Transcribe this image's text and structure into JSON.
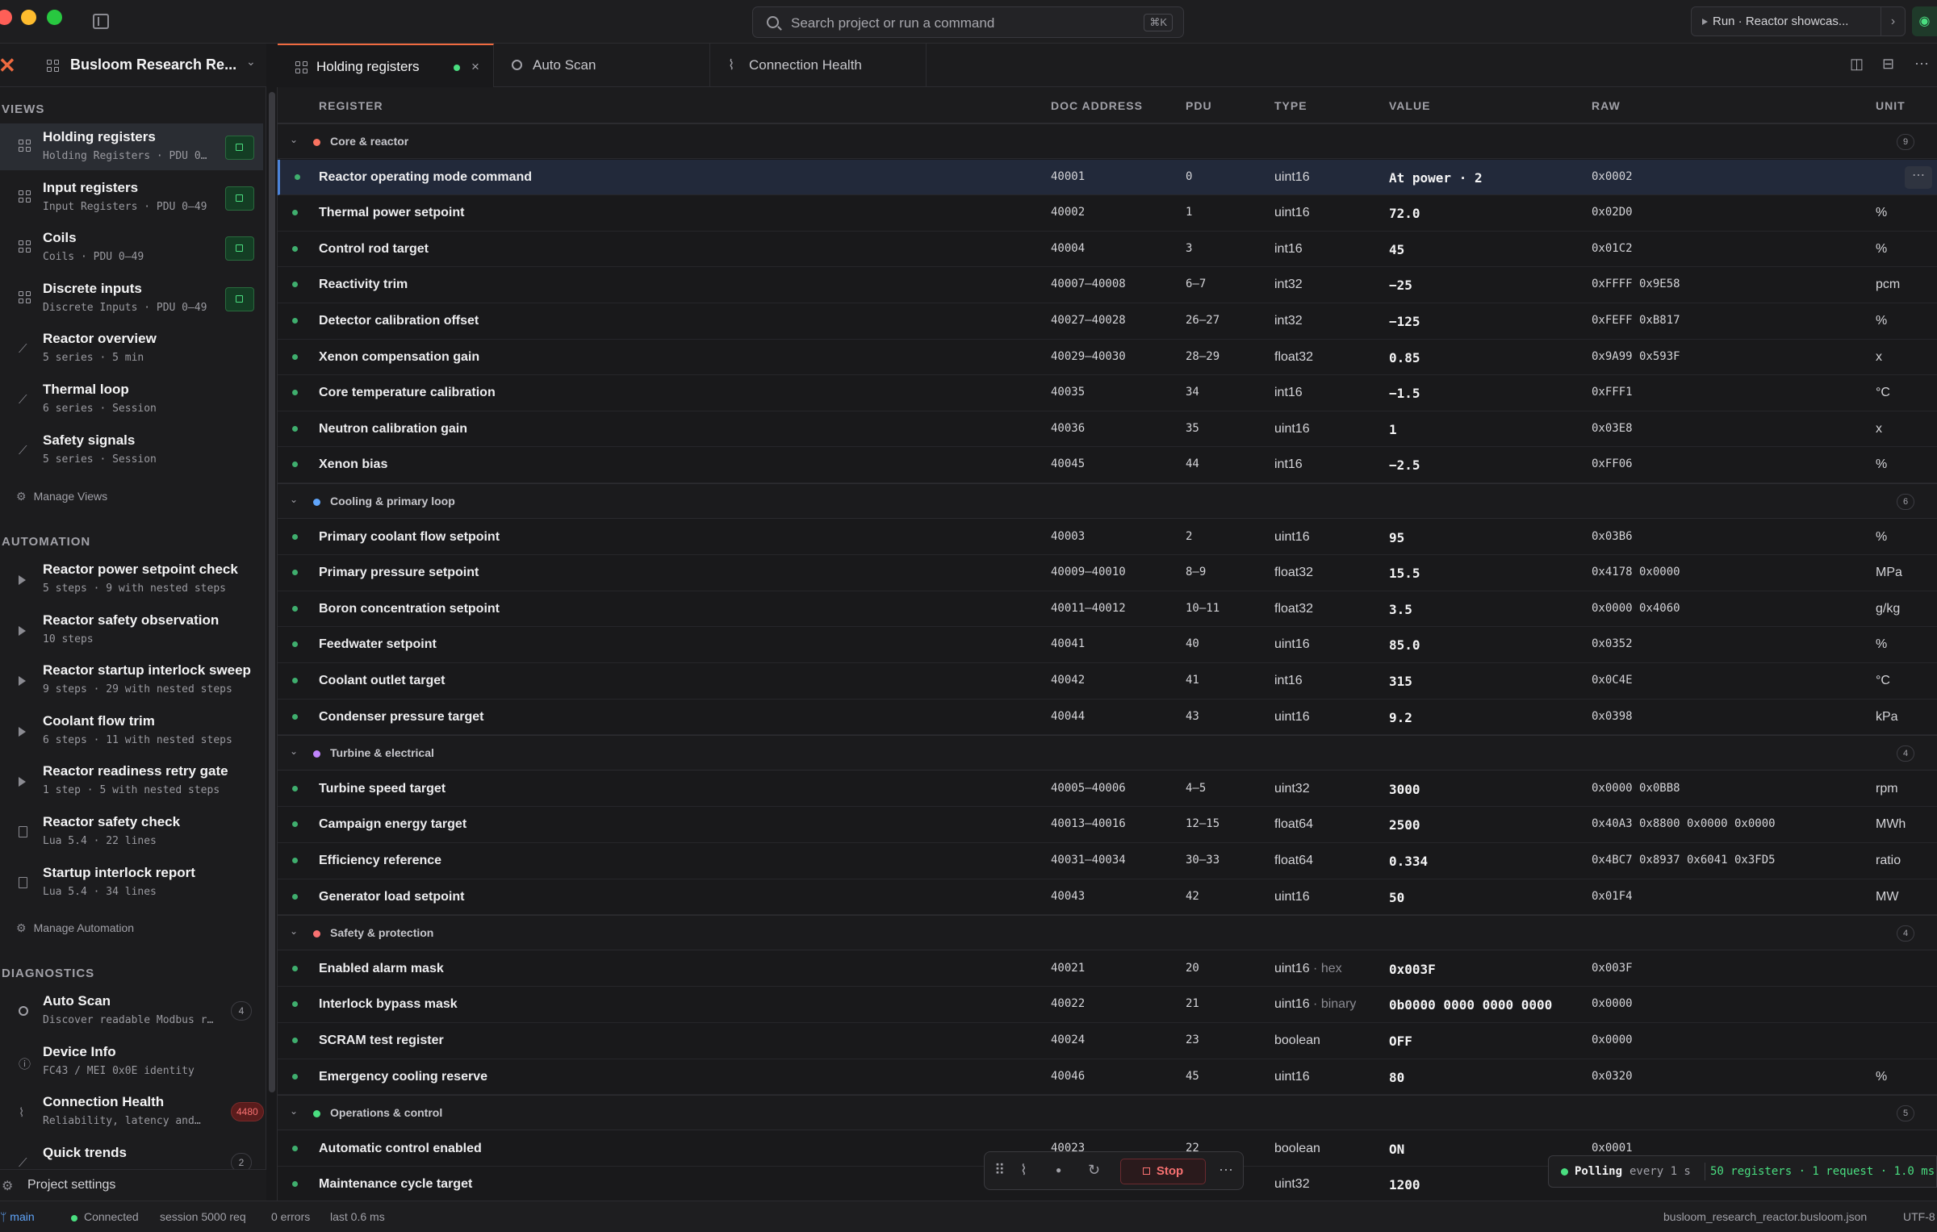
{
  "topbar": {
    "search_placeholder": "Search project or run a command",
    "search_shortcut": "⌘K",
    "run_label": "Run · Reactor showcas..."
  },
  "project": {
    "name": "Busloom Research Re..."
  },
  "tabs": [
    {
      "label": "Holding registers",
      "icon": "grid-icon",
      "dirty": true
    },
    {
      "label": "Auto Scan",
      "icon": "search-icon"
    },
    {
      "label": "Connection Health",
      "icon": "pulse-icon"
    }
  ],
  "sidebar": {
    "views_title": "VIEWS",
    "views": [
      {
        "title": "Holding registers",
        "sub": "Holding Registers · PDU 0…",
        "icon": "grid-icon",
        "live": true
      },
      {
        "title": "Input registers",
        "sub": "Input Registers · PDU 0–49",
        "icon": "grid-icon",
        "live": true
      },
      {
        "title": "Coils",
        "sub": "Coils · PDU 0–49",
        "icon": "grid-icon",
        "live": true
      },
      {
        "title": "Discrete inputs",
        "sub": "Discrete Inputs · PDU 0–49",
        "icon": "grid-icon",
        "live": true
      },
      {
        "title": "Reactor overview",
        "sub": "5 series · 5 min",
        "icon": "chart-icon"
      },
      {
        "title": "Thermal loop",
        "sub": "6 series · Session",
        "icon": "chart-icon"
      },
      {
        "title": "Safety signals",
        "sub": "5 series · Session",
        "icon": "chart-icon"
      }
    ],
    "manage_views": "Manage Views",
    "automation_title": "AUTOMATION",
    "automation": [
      {
        "title": "Reactor power setpoint check",
        "sub": "5 steps · 9 with nested steps",
        "icon": "play-icon"
      },
      {
        "title": "Reactor safety observation",
        "sub": "10 steps",
        "icon": "play-icon"
      },
      {
        "title": "Reactor startup interlock sweep",
        "sub": "9 steps · 29 with nested steps",
        "icon": "play-icon"
      },
      {
        "title": "Coolant flow trim",
        "sub": "6 steps · 11 with nested steps",
        "icon": "play-icon"
      },
      {
        "title": "Reactor readiness retry gate",
        "sub": "1 step · 5 with nested steps",
        "icon": "play-icon"
      },
      {
        "title": "Reactor safety check",
        "sub": "Lua 5.4 · 22 lines",
        "icon": "script-icon"
      },
      {
        "title": "Startup interlock report",
        "sub": "Lua 5.4 · 34 lines",
        "icon": "script-icon"
      }
    ],
    "manage_automation": "Manage Automation",
    "diagnostics_title": "DIAGNOSTICS",
    "diagnostics": [
      {
        "title": "Auto Scan",
        "sub": "Discover readable Modbus r…",
        "icon": "search-icon",
        "badge": "4"
      },
      {
        "title": "Device Info",
        "sub": "FC43 / MEI 0x0E identity",
        "icon": "info-icon"
      },
      {
        "title": "Connection Health",
        "sub": "Reliability, latency and…",
        "icon": "pulse-icon",
        "badge": "4480",
        "badge_color": "#f87171"
      },
      {
        "title": "Quick trends",
        "sub": "",
        "icon": "chart-icon",
        "badge": "2"
      }
    ],
    "project_settings": "Project settings"
  },
  "table": {
    "headers": {
      "register": "REGISTER",
      "doc": "DOC ADDRESS",
      "pdu": "PDU",
      "type": "TYPE",
      "value": "VALUE",
      "raw": "RAW",
      "unit": "UNIT"
    },
    "groups": [
      {
        "name": "Core & reactor",
        "color": "#f97360",
        "count": "9",
        "rows": [
          {
            "name": "Reactor operating mode command",
            "addr": "40001",
            "pdu": "0",
            "type": "uint16",
            "value": "At power · 2",
            "raw": "0x0002",
            "unit": "",
            "selected": true
          },
          {
            "name": "Thermal power setpoint",
            "addr": "40002",
            "pdu": "1",
            "type": "uint16",
            "value": "72.0",
            "raw": "0x02D0",
            "unit": "%"
          },
          {
            "name": "Control rod target",
            "addr": "40004",
            "pdu": "3",
            "type": "int16",
            "value": "45",
            "raw": "0x01C2",
            "unit": "%"
          },
          {
            "name": "Reactivity trim",
            "addr": "40007–40008",
            "pdu": "6–7",
            "type": "int32",
            "value": "−25",
            "raw": "0xFFFF 0x9E58",
            "unit": "pcm"
          },
          {
            "name": "Detector calibration offset",
            "addr": "40027–40028",
            "pdu": "26–27",
            "type": "int32",
            "value": "−125",
            "raw": "0xFEFF 0xB817",
            "unit": "%"
          },
          {
            "name": "Xenon compensation gain",
            "addr": "40029–40030",
            "pdu": "28–29",
            "type": "float32",
            "value": "0.85",
            "raw": "0x9A99 0x593F",
            "unit": "x"
          },
          {
            "name": "Core temperature calibration",
            "addr": "40035",
            "pdu": "34",
            "type": "int16",
            "value": "−1.5",
            "raw": "0xFFF1",
            "unit": "°C"
          },
          {
            "name": "Neutron calibration gain",
            "addr": "40036",
            "pdu": "35",
            "type": "uint16",
            "value": "1",
            "raw": "0x03E8",
            "unit": "x"
          },
          {
            "name": "Xenon bias",
            "addr": "40045",
            "pdu": "44",
            "type": "int16",
            "value": "−2.5",
            "raw": "0xFF06",
            "unit": "%"
          }
        ]
      },
      {
        "name": "Cooling & primary loop",
        "color": "#60a5fa",
        "count": "6",
        "rows": [
          {
            "name": "Primary coolant flow setpoint",
            "addr": "40003",
            "pdu": "2",
            "type": "uint16",
            "value": "95",
            "raw": "0x03B6",
            "unit": "%"
          },
          {
            "name": "Primary pressure setpoint",
            "addr": "40009–40010",
            "pdu": "8–9",
            "type": "float32",
            "value": "15.5",
            "raw": "0x4178 0x0000",
            "unit": "MPa"
          },
          {
            "name": "Boron concentration setpoint",
            "addr": "40011–40012",
            "pdu": "10–11",
            "type": "float32",
            "value": "3.5",
            "raw": "0x0000 0x4060",
            "unit": "g/kg"
          },
          {
            "name": "Feedwater setpoint",
            "addr": "40041",
            "pdu": "40",
            "type": "uint16",
            "value": "85.0",
            "raw": "0x0352",
            "unit": "%"
          },
          {
            "name": "Coolant outlet target",
            "addr": "40042",
            "pdu": "41",
            "type": "int16",
            "value": "315",
            "raw": "0x0C4E",
            "unit": "°C"
          },
          {
            "name": "Condenser pressure target",
            "addr": "40044",
            "pdu": "43",
            "type": "uint16",
            "value": "9.2",
            "raw": "0x0398",
            "unit": "kPa"
          }
        ]
      },
      {
        "name": "Turbine & electrical",
        "color": "#c084fc",
        "count": "4",
        "rows": [
          {
            "name": "Turbine speed target",
            "addr": "40005–40006",
            "pdu": "4–5",
            "type": "uint32",
            "value": "3000",
            "raw": "0x0000 0x0BB8",
            "unit": "rpm"
          },
          {
            "name": "Campaign energy target",
            "addr": "40013–40016",
            "pdu": "12–15",
            "type": "float64",
            "value": "2500",
            "raw": "0x40A3 0x8800 0x0000 0x0000",
            "unit": "MWh"
          },
          {
            "name": "Efficiency reference",
            "addr": "40031–40034",
            "pdu": "30–33",
            "type": "float64",
            "value": "0.334",
            "raw": "0x4BC7 0x8937 0x6041 0x3FD5",
            "unit": "ratio"
          },
          {
            "name": "Generator load setpoint",
            "addr": "40043",
            "pdu": "42",
            "type": "uint16",
            "value": "50",
            "raw": "0x01F4",
            "unit": "MW"
          }
        ]
      },
      {
        "name": "Safety & protection",
        "color": "#f87171",
        "count": "4",
        "rows": [
          {
            "name": "Enabled alarm mask",
            "addr": "40021",
            "pdu": "20",
            "type": "uint16",
            "type_extra": "· hex",
            "value": "0x003F",
            "raw": "0x003F",
            "unit": ""
          },
          {
            "name": "Interlock bypass mask",
            "addr": "40022",
            "pdu": "21",
            "type": "uint16",
            "type_extra": "· binary",
            "value": "0b0000 0000 0000 0000",
            "raw": "0x0000",
            "unit": ""
          },
          {
            "name": "SCRAM test register",
            "addr": "40024",
            "pdu": "23",
            "type": "boolean",
            "value": "OFF",
            "raw": "0x0000",
            "unit": ""
          },
          {
            "name": "Emergency cooling reserve",
            "addr": "40046",
            "pdu": "45",
            "type": "uint16",
            "value": "80",
            "raw": "0x0320",
            "unit": "%"
          }
        ]
      },
      {
        "name": "Operations & control",
        "color": "#4ade80",
        "count": "5",
        "rows": [
          {
            "name": "Automatic control enabled",
            "addr": "40023",
            "pdu": "22",
            "type": "boolean",
            "value": "ON",
            "raw": "0x0001",
            "unit": ""
          },
          {
            "name": "Maintenance cycle target",
            "addr": "",
            "pdu": "",
            "type": "uint32",
            "value": "1200",
            "raw": "",
            "unit": ""
          }
        ]
      }
    ]
  },
  "controls": {
    "stop_label": "Stop"
  },
  "polling": {
    "label": "Polling",
    "interval": "every 1 s",
    "stats": "50 registers · 1 request · 1.0 ms"
  },
  "status": {
    "branch": "main",
    "connection": "Connected",
    "session": "session 5000 req",
    "errors": "0 errors",
    "last": "last 0.6 ms",
    "file": "busloom_research_reactor.busloom.json",
    "encoding": "UTF-8"
  }
}
